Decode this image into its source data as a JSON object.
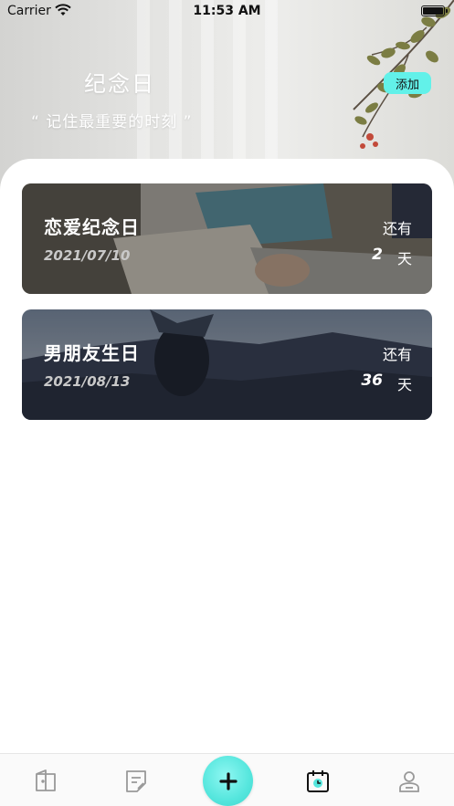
{
  "status_bar": {
    "carrier": "Carrier",
    "time": "11:53 AM",
    "wifi_icon": "wifi-icon",
    "battery_icon": "battery-icon"
  },
  "header": {
    "title": "纪念日",
    "subtitle": "“ 记住最重要的时刻 ”",
    "add_label": "添加",
    "accent_color": "#62f1e9"
  },
  "anniversaries": [
    {
      "name": "恋爱纪念日",
      "date": "2021/07/10",
      "remain_label": "还有",
      "days": "2",
      "unit": "天"
    },
    {
      "name": "男朋友生日",
      "date": "2021/08/13",
      "remain_label": "还有",
      "days": "36",
      "unit": "天"
    }
  ],
  "tab_bar": {
    "items": [
      {
        "icon": "door-icon",
        "active": false
      },
      {
        "icon": "note-edit-icon",
        "active": false
      },
      {
        "icon": "plus-icon",
        "active": false
      },
      {
        "icon": "calendar-clock-icon",
        "active": true
      },
      {
        "icon": "profile-icon",
        "active": false
      }
    ]
  }
}
